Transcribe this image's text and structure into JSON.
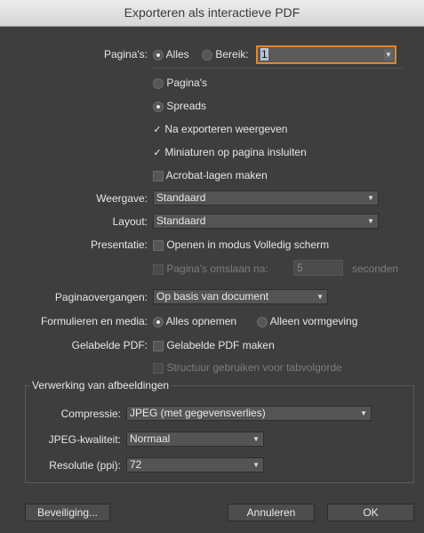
{
  "window": {
    "title": "Exporteren als interactieve PDF"
  },
  "pages": {
    "label": "Pagina's:",
    "all_label": "Alles",
    "range_label": "Bereik:",
    "range_value": "1",
    "pages_option": "Pagina's",
    "spreads_option": "Spreads"
  },
  "options": {
    "view_after_export": "Na exporteren weergeven",
    "embed_thumbnails": "Miniaturen op pagina insluiten",
    "create_acrobat_layers": "Acrobat-lagen maken"
  },
  "view": {
    "label": "Weergave:",
    "value": "Standaard"
  },
  "layout": {
    "label": "Layout:",
    "value": "Standaard"
  },
  "presentation": {
    "label": "Presentatie:",
    "fullscreen": "Openen in modus Volledig scherm",
    "flip_pages": "Pagina's omslaan na:",
    "seconds_value": "5",
    "seconds_label": "seconden"
  },
  "transitions": {
    "label": "Paginaovergangen:",
    "value": "Op basis van document"
  },
  "forms_media": {
    "label": "Formulieren en media:",
    "include_all": "Alles opnemen",
    "appearance_only": "Alleen vormgeving"
  },
  "tagged_pdf": {
    "label": "Gelabelde PDF:",
    "create": "Gelabelde PDF maken",
    "tab_order": "Structuur gebruiken voor tabvolgorde"
  },
  "image_handling": {
    "legend": "Verwerking van afbeeldingen",
    "compression_label": "Compressie:",
    "compression_value": "JPEG (met gegevensverlies)",
    "jpeg_quality_label": "JPEG-kwaliteit:",
    "jpeg_quality_value": "Normaal",
    "resolution_label": "Resolutie (ppi):",
    "resolution_value": "72"
  },
  "buttons": {
    "security": "Beveiliging...",
    "cancel": "Annuleren",
    "ok": "OK"
  },
  "colors": {
    "accent_focus": "#e0862c",
    "dialog_bg": "#3e3e3e"
  }
}
